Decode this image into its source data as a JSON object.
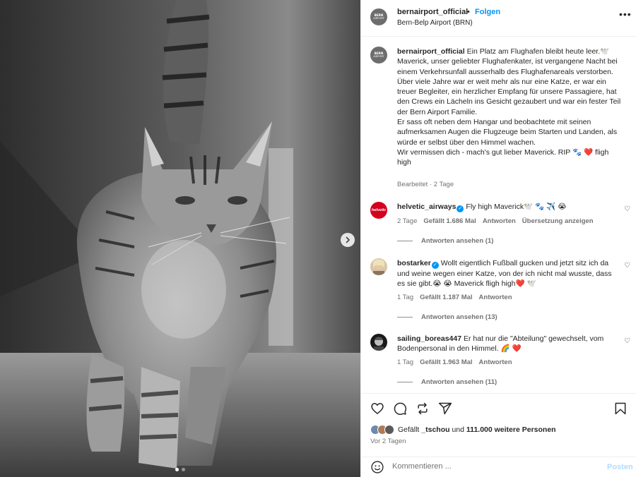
{
  "media": {
    "image_alt": "Schwarz-weiß Foto einer getigerten Katze",
    "slide_count": 2,
    "active_slide": 1
  },
  "header": {
    "avatar_line1": "BERN",
    "avatar_line2": "AIRPORT",
    "username": "bernairport_official",
    "separator": "•",
    "follow_label": "Folgen",
    "location": "Bern-Belp Airport (BRN)",
    "more_label": "•••"
  },
  "caption": {
    "username": "bernairport_official",
    "lines": [
      "Ein Platz am Flughafen bleibt heute leer.🕊️ Maverick, unser geliebter Flughafenkater, ist vergangene Nacht bei einem Verkehrsunfall ausserhalb des Flughafenareals verstorben.",
      "Über viele Jahre war er weit mehr als nur eine Katze, er war ein treuer Begleiter, ein herzlicher Empfang für unsere Passagiere, hat den Crews ein Lächeln ins Gesicht gezaubert und war ein fester Teil der Bern Airport Familie.",
      "Er sass oft neben dem Hangar und beobachtete mit seinen aufmerksamen Augen die Flugzeuge beim Starten und Landen, als würde er selbst über den Himmel wachen.",
      "Wir vermissen dich - mach's gut lieber Maverick. RIP 🐾 ❤️ fligh high"
    ],
    "meta": "Bearbeitet · 2 Tage"
  },
  "comments": [
    {
      "username": "helvetic_airways",
      "verified": true,
      "avatar_text": "helvetic",
      "text": "Fly high Maverick🕊️ 🐾 ✈️ 😭",
      "time": "2 Tage",
      "likes": "Gefällt 1.686 Mal",
      "reply": "Antworten",
      "translate": "Übersetzung anzeigen",
      "replies": "Antworten ansehen (1)"
    },
    {
      "username": "bostarker",
      "verified": true,
      "text": "Wollt eigentlich Fußball gucken und jetzt sitz ich da und weine wegen einer Katze, von der ich nicht mal wusste, dass es sie gibt.😭 😭 Maverick fligh high❤️ 🕊️",
      "time": "1 Tag",
      "likes": "Gefällt 1.187 Mal",
      "reply": "Antworten",
      "replies": "Antworten ansehen (13)"
    },
    {
      "username": "sailing_boreas447",
      "verified": false,
      "text": "Er hat nur die \"Abteilung\" gewechselt, vom Bodenpersonal in den Himmel. 🌈 ❤️",
      "time": "1 Tag",
      "likes": "Gefällt 1.963 Mal",
      "reply": "Antworten",
      "replies": "Antworten ansehen (11)"
    }
  ],
  "likes": {
    "prefix": "Gefällt",
    "user": "_tschou",
    "middle": "und",
    "others": "111.000 weitere Personen",
    "time_ago": "Vor 2 Tagen"
  },
  "comment_box": {
    "placeholder": "Kommentieren ...",
    "post_label": "Posten"
  },
  "colors": {
    "accent": "#0095f6",
    "text": "#262626",
    "muted": "#737373",
    "heart": "#e0245e"
  }
}
